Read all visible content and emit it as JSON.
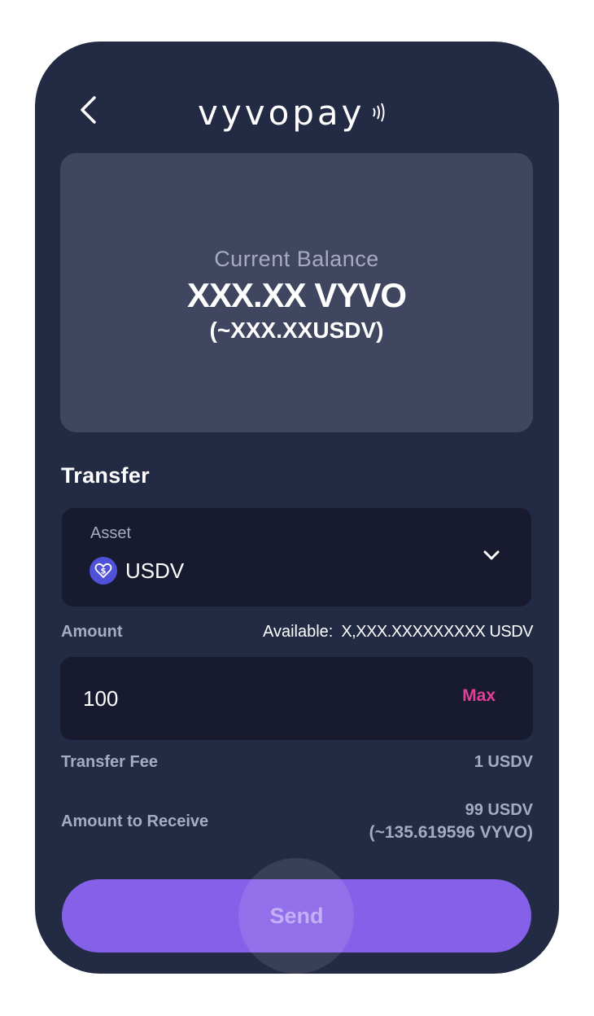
{
  "header": {
    "logo_text": "vyvopay"
  },
  "balance": {
    "label": "Current Balance",
    "value": "XXX.XX VYVO",
    "equivalent": "(~XXX.XXUSDV)"
  },
  "transfer": {
    "title": "Transfer",
    "asset": {
      "label": "Asset",
      "selected": "USDV",
      "icon": "usdv-coin-icon"
    },
    "amount": {
      "label": "Amount",
      "available_label": "Available:",
      "available_value": "X,XXX.XXXXXXXXX USDV",
      "value": "100",
      "max_label": "Max"
    },
    "fee": {
      "label": "Transfer Fee",
      "value": "1 USDV"
    },
    "receive": {
      "label": "Amount to Receive",
      "value": "99 USDV",
      "equivalent": "(~135.619596 VYVO)"
    },
    "send_label": "Send"
  },
  "colors": {
    "background": "#232a43",
    "card": "#414660",
    "input": "#181b30",
    "accent": "#8560e8",
    "max": "#e23d99"
  }
}
